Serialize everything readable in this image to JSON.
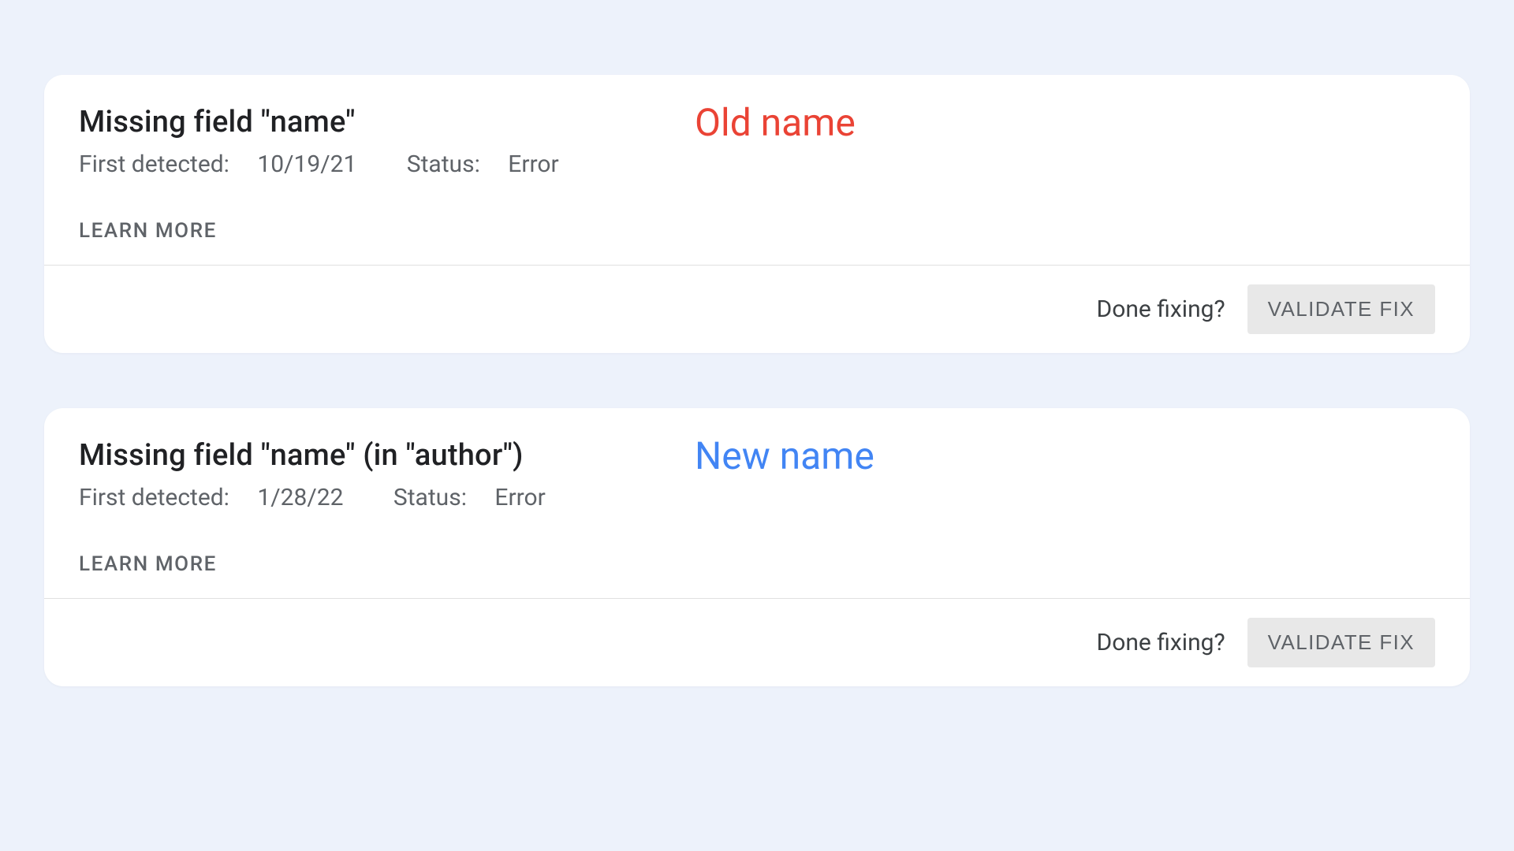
{
  "cards": [
    {
      "title": "Missing field \"name\"",
      "first_detected_label": "First detected:",
      "first_detected_value": "10/19/21",
      "status_label": "Status:",
      "status_value": "Error",
      "learn_more": "LEARN MORE",
      "annotation": "Old name",
      "annotation_class": "annotation-old",
      "footer_text": "Done fixing?",
      "validate_button": "VALIDATE FIX"
    },
    {
      "title": "Missing field \"name\" (in \"author\")",
      "first_detected_label": "First detected:",
      "first_detected_value": "1/28/22",
      "status_label": "Status:",
      "status_value": "Error",
      "learn_more": "LEARN MORE",
      "annotation": "New name",
      "annotation_class": "annotation-new",
      "footer_text": "Done fixing?",
      "validate_button": "VALIDATE FIX"
    }
  ]
}
